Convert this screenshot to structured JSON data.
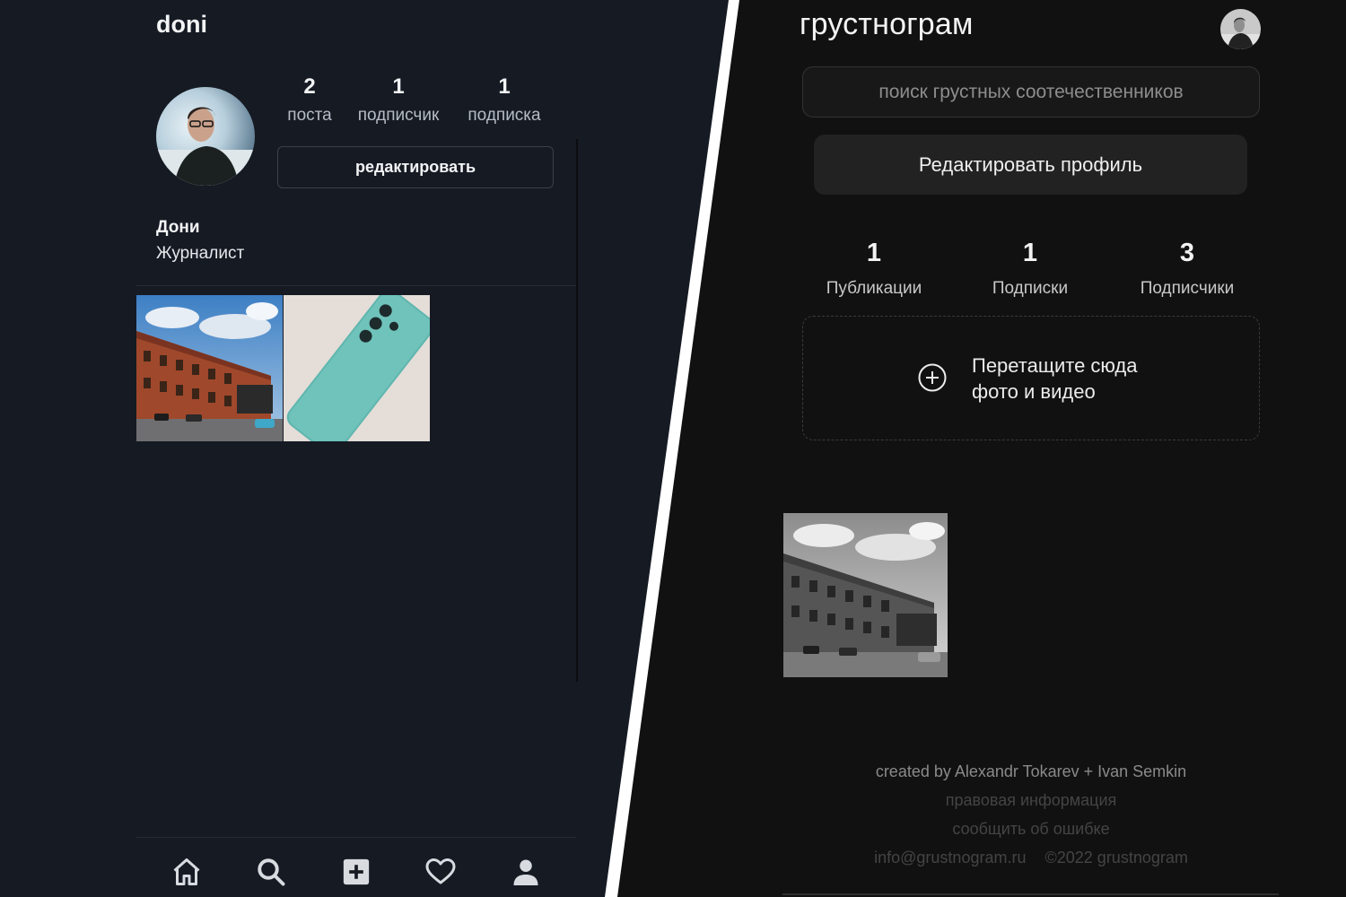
{
  "left": {
    "username": "doni",
    "stats": [
      {
        "value": "2",
        "label": "поста"
      },
      {
        "value": "1",
        "label": "подписчик"
      },
      {
        "value": "1",
        "label": "подписка"
      }
    ],
    "edit_button": "редактировать",
    "display_name": "Дони",
    "bio": "Журналист",
    "nav": [
      "home-icon",
      "search-icon",
      "add-post-icon",
      "heart-icon",
      "profile-icon"
    ]
  },
  "right": {
    "app_title": "грустнограм",
    "search_placeholder": "поиск грустных соотечественников",
    "edit_button": "Редактировать профиль",
    "stats": [
      {
        "value": "1",
        "label": "Публикации"
      },
      {
        "value": "1",
        "label": "Подписки"
      },
      {
        "value": "3",
        "label": "Подписчики"
      }
    ],
    "dropzone_text_line1": "Перетащите сюда",
    "dropzone_text_line2": "фото и видео",
    "footer": {
      "credit": "created by Alexandr Tokarev + Ivan Semkin",
      "legal": "правовая информация",
      "report": "сообщить об ошибке",
      "email": "info@grustnogram.ru",
      "copyright": "©2022 grustnogram"
    }
  },
  "colors": {
    "left_bg": "#151a23",
    "right_bg": "#111111",
    "divider": "#ffffff"
  }
}
